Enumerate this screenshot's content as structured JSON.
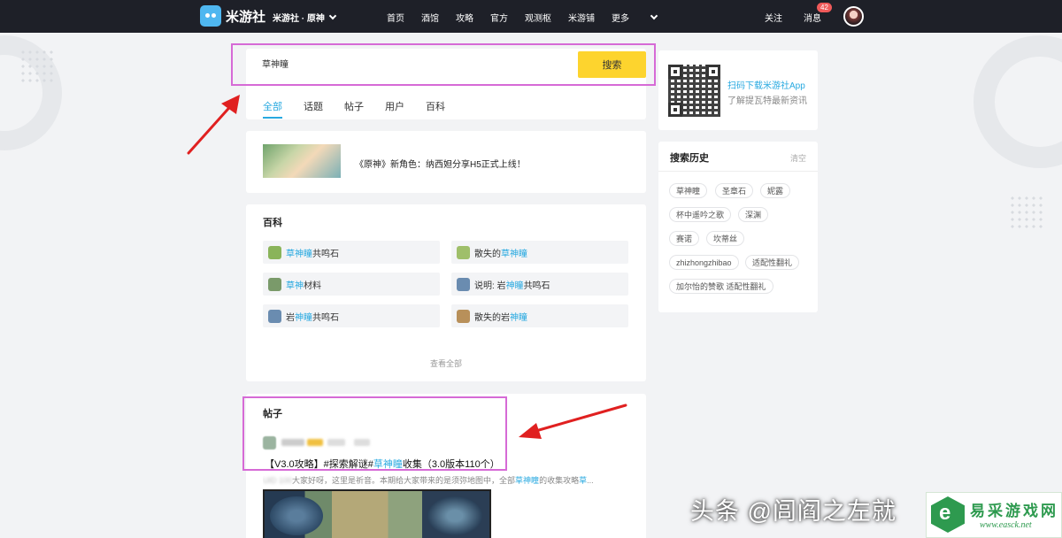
{
  "topbar": {
    "logo_text": "米游社",
    "community": "米游社 · 原神",
    "nav": [
      "首页",
      "酒馆",
      "攻略",
      "官方",
      "观测枢",
      "米游铺"
    ],
    "more": "更多",
    "follow": "关注",
    "messages": "消息",
    "message_count": "42"
  },
  "search": {
    "value": "草神瞳",
    "button": "搜索",
    "tabs": [
      "全部",
      "话题",
      "帖子",
      "用户",
      "百科"
    ],
    "active_tab": "全部"
  },
  "news": {
    "title": "《原神》新角色：纳西妲分享H5正式上线！"
  },
  "wiki": {
    "heading": "百科",
    "items": [
      {
        "pre": "",
        "hl": "草神瞳",
        "post": "共鸣石"
      },
      {
        "pre": "散失的",
        "hl": "草神瞳",
        "post": ""
      },
      {
        "pre": "",
        "hl": "草神",
        "post": "材料"
      },
      {
        "pre": "说明: 岩",
        "hl": "神瞳",
        "post": "共鸣石"
      },
      {
        "pre": "岩",
        "hl": "神瞳",
        "post": "共鸣石"
      },
      {
        "pre": "散失的岩",
        "hl": "神瞳",
        "post": ""
      }
    ],
    "view_all": "查看全部"
  },
  "posts": {
    "heading": "帖子",
    "title_pre": "【V3.0攻略】#探索解谜#",
    "title_hl": "草神瞳",
    "title_post": "收集（3.0版本110个）",
    "desc_blur": "UID 100",
    "desc_pre": "大家好呀，这里是祈音。本期给大家带来的是须弥地图中，全部",
    "desc_hl": "草神瞳",
    "desc_post": "的收集攻略",
    "desc_hl2": "草",
    "desc_ellipsis": "..."
  },
  "sidebar": {
    "qr_line1": "扫码下载米游社App",
    "qr_line2": "了解提瓦特最新资讯",
    "history_title": "搜索历史",
    "history_clear": "清空",
    "history_tags": [
      "草神瞳",
      "圣章石",
      "妮露",
      "杯中遥吟之歌",
      "深渊",
      "赛诺",
      "坎蒂丝",
      "zhizhongzhibao",
      "适配性翻礼",
      "加尔怡的赞歌 适配性翻礼"
    ]
  },
  "watermark": {
    "text": "头条 @闾阎之左就",
    "site_cn": "易采游戏网",
    "site_url": "www.easck.net"
  },
  "colors": {
    "accent": "#28a9e0",
    "search_button": "#fdd42e",
    "highlight_box": "#d66ad6",
    "arrow": "#e02020",
    "topbar": "#1e2028"
  }
}
